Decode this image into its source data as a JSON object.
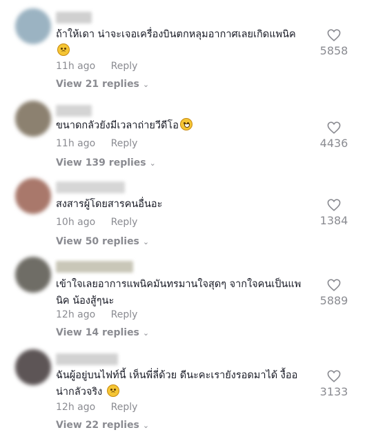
{
  "comments": [
    {
      "text": "ถ้าให้เดา น่าจะเจอเครื่องบินตกหลุมอากาศเลยเกิดแพนิค",
      "emoji": "worried-face-icon",
      "time": "11h ago",
      "reply_label": "Reply",
      "view_replies": "View 21 replies",
      "likes": "5858",
      "avatar_color": "#9bb3c2"
    },
    {
      "text": "ขนาดกลัวยังมีเวลาถ่ายวีดีโอ",
      "emoji": "laughing-tears-icon",
      "time": "11h ago",
      "reply_label": "Reply",
      "view_replies": "View 139 replies",
      "likes": "4436",
      "avatar_color": "#8c8170"
    },
    {
      "text": "สงสารผู้โดยสารคนอื่นอะ",
      "time": "10h ago",
      "reply_label": "Reply",
      "view_replies": "View 50 replies",
      "likes": "1384",
      "avatar_color": "#a9786b"
    },
    {
      "text_line1": "เข้าใจเลยอาการแพนิคมันทรมานใจสุดๆ จากใจคนเป็นแพ",
      "text_line2": "นิค น้องสู้ๆนะ",
      "time": "12h ago",
      "reply_label": "Reply",
      "view_replies": "View 14 replies",
      "likes": "5889",
      "avatar_color": "#6f6d66"
    },
    {
      "text_line1": "ฉันผู้อยู่บนไฟท์นี้ เห็นพี่ลี่ด้วย ดีนะคะเรายังรอดมาได้ งื้ออ",
      "text_line2": "น่ากลัวจริง",
      "emoji": "worried-face-icon",
      "time": "12h ago",
      "reply_label": "Reply",
      "view_replies": "View 22 replies",
      "likes": "3133",
      "avatar_color": "#5d5556"
    }
  ]
}
